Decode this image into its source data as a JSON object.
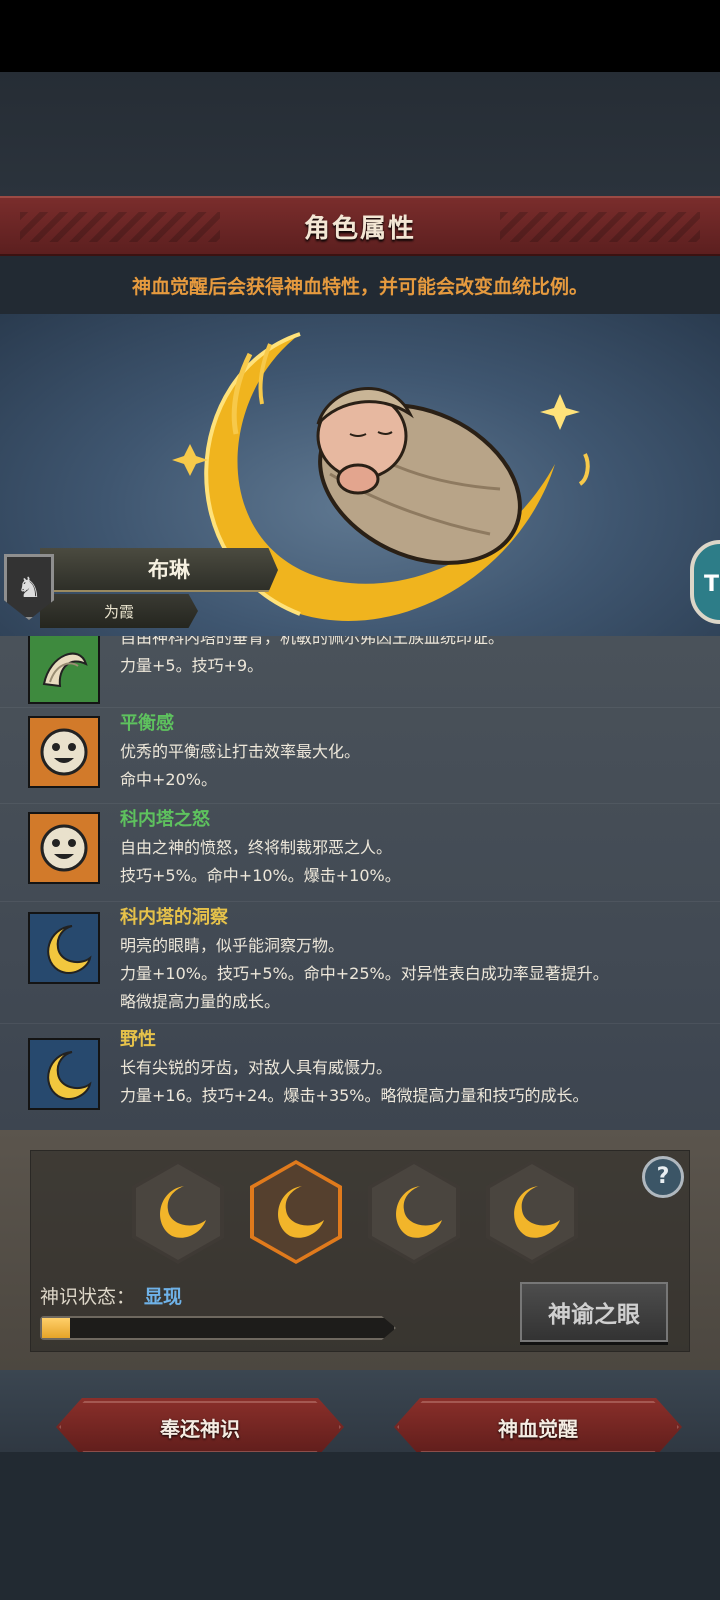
{
  "header": {
    "title": "角色属性",
    "subtitle": "神血觉醒后会获得神血特性，并可能会改变血统比例。"
  },
  "character": {
    "name": "布琳",
    "subname": "为霞",
    "side_tab_letter": "T"
  },
  "traits": [
    {
      "name": "",
      "name_color": "#5ec25e",
      "icon": "wind-swirl-icon",
      "icon_bg": "#3e8a3e",
      "lines": [
        "自由神科内塔的垂青，机敏的佩尔弗因王族血统印证。",
        "力量+5。技巧+9。"
      ]
    },
    {
      "name": "平衡感",
      "name_color": "#5ec25e",
      "icon": "smile-face-icon",
      "icon_bg": "#d27a2a",
      "lines": [
        "优秀的平衡感让打击效率最大化。",
        "命中+20%。"
      ]
    },
    {
      "name": "科内塔之怒",
      "name_color": "#5ec25e",
      "icon": "smile-face-icon",
      "icon_bg": "#d27a2a",
      "lines": [
        "自由之神的愤怒，终将制裁邪恶之人。",
        "技巧+5%。命中+10%。爆击+10%。"
      ]
    },
    {
      "name": "科内塔的洞察",
      "name_color": "#e6c24a",
      "icon": "crescent-moon-icon",
      "icon_bg": "#27496e",
      "lines": [
        "明亮的眼睛，似乎能洞察万物。",
        "力量+10%。技巧+5%。命中+25%。对异性表白成功率显著提升。",
        "略微提高力量的成长。"
      ]
    },
    {
      "name": "野性",
      "name_color": "#e6c24a",
      "icon": "crescent-moon-icon",
      "icon_bg": "#27496e",
      "lines": [
        "长有尖锐的牙齿，对敌人具有威慑力。",
        "力量+16。技巧+24。爆击+35%。略微提高力量和技巧的成长。"
      ]
    }
  ],
  "slots": [
    {
      "icon": "crescent-moon-icon",
      "selected": false
    },
    {
      "icon": "crescent-moon-icon",
      "selected": true
    },
    {
      "icon": "crescent-moon-icon",
      "selected": false
    },
    {
      "icon": "crescent-moon-icon",
      "selected": false
    }
  ],
  "status": {
    "label": "神识状态：",
    "value": "显现",
    "progress": 0.08
  },
  "help_label": "?",
  "buttons": {
    "oracle": "神谕之眼",
    "return": "奉还神识",
    "awaken": "神血觉醒"
  }
}
